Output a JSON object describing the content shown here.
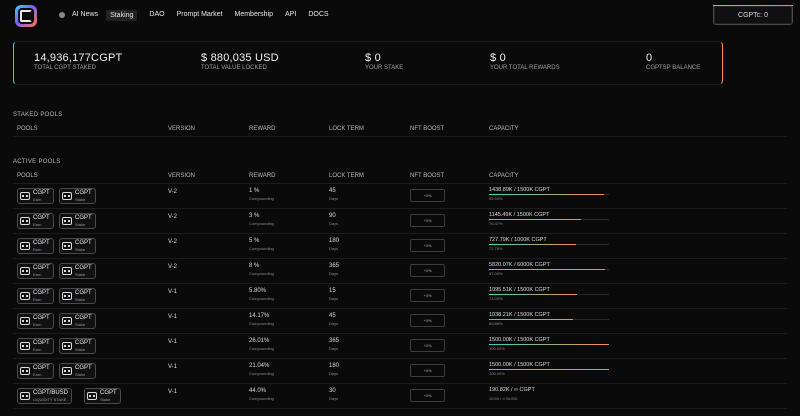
{
  "nav": {
    "items": [
      "AI News",
      "Staking",
      "DAO",
      "Prompt Market",
      "Membership",
      "API",
      "DOCS"
    ],
    "active": 1,
    "wallet_label": "CGPTc: 0"
  },
  "stats": [
    {
      "value": "14,936,177CGPT",
      "label": "TOTAL CGPT STAKED"
    },
    {
      "value": "$ 880,035 USD",
      "label": "TOTAL VALUE LOCKED"
    },
    {
      "value": "$ 0",
      "label": "YOUR STAKE"
    },
    {
      "value": "$ 0",
      "label": "YOUR TOTAL REWARDS"
    },
    {
      "value": "0",
      "label": "CGPTsp BALANCE"
    }
  ],
  "staked_pools": {
    "title": "STAKED POOLS",
    "headers": [
      "POOLS",
      "VERSION",
      "REWARD",
      "LOCK TERM",
      "NFT BOOST",
      "CAPACITY"
    ]
  },
  "active_pools": {
    "title": "ACTIVE POOLS",
    "headers": [
      "POOLS",
      "VERSION",
      "REWARD",
      "LOCK TERM",
      "NFT BOOST",
      "CAPACITY"
    ],
    "rows": [
      {
        "b1": {
          "t": "CGPT",
          "s": "Earn"
        },
        "b2": {
          "t": "CGPT",
          "s": "Stake"
        },
        "version": "V-2",
        "reward": "1 %",
        "reward_sub": "Compounding",
        "lock": "45",
        "lock_sub": "Days",
        "boost": "+0%",
        "cap": "1438.89K / 1500K CGPT",
        "cap_pct": "95.93%",
        "fill": 0.9593
      },
      {
        "b1": {
          "t": "CGPT",
          "s": "Earn"
        },
        "b2": {
          "t": "CGPT",
          "s": "Stake"
        },
        "version": "V-2",
        "reward": "3 %",
        "reward_sub": "Compounding",
        "lock": "90",
        "lock_sub": "Days",
        "boost": "+0%",
        "cap": "1145.49K / 1500K CGPT",
        "cap_pct": "76.37%",
        "fill": 0.7637
      },
      {
        "b1": {
          "t": "CGPT",
          "s": "Earn"
        },
        "b2": {
          "t": "CGPT",
          "s": "Stake"
        },
        "version": "V-2",
        "reward": "5 %",
        "reward_sub": "Compounding",
        "lock": "180",
        "lock_sub": "Days",
        "boost": "+0%",
        "cap": "727.79K / 1000K CGPT",
        "cap_pct": "72.78%",
        "fill": 0.7278
      },
      {
        "b1": {
          "t": "CGPT",
          "s": "Earn"
        },
        "b2": {
          "t": "CGPT",
          "s": "Stake"
        },
        "version": "V-2",
        "reward": "8 %",
        "reward_sub": "Compounding",
        "lock": "365",
        "lock_sub": "Days",
        "boost": "+0%",
        "cap": "5820.07K / 6000K CGPT",
        "cap_pct": "97.00%",
        "fill": 0.97
      },
      {
        "b1": {
          "t": "CGPT",
          "s": "Earn"
        },
        "b2": {
          "t": "CGPT",
          "s": "Stake"
        },
        "version": "V-1",
        "reward": "5.80%",
        "reward_sub": "Compounding",
        "lock": "15",
        "lock_sub": "Days",
        "boost": "+0%",
        "cap": "1095.51K / 1500K CGPT",
        "cap_pct": "73.03%",
        "fill": 0.7303
      },
      {
        "b1": {
          "t": "CGPT",
          "s": "Earn"
        },
        "b2": {
          "t": "CGPT",
          "s": "Stake"
        },
        "version": "V-1",
        "reward": "14.17%",
        "reward_sub": "Compounding",
        "lock": "45",
        "lock_sub": "Days",
        "boost": "+0%",
        "cap": "1038.21K / 1500K CGPT",
        "cap_pct": "69.88%",
        "fill": 0.6988
      },
      {
        "b1": {
          "t": "CGPT",
          "s": "Earn"
        },
        "b2": {
          "t": "CGPT",
          "s": "Stake"
        },
        "version": "V-1",
        "reward": "26.01%",
        "reward_sub": "Compounding",
        "lock": "365",
        "lock_sub": "Days",
        "boost": "+0%",
        "cap": "1500.00K / 1500K CGPT",
        "cap_pct": "100.00%",
        "fill": 1.0
      },
      {
        "b1": {
          "t": "CGPT",
          "s": "Earn"
        },
        "b2": {
          "t": "CGPT",
          "s": "Stake"
        },
        "version": "V-1",
        "reward": "21.04%",
        "reward_sub": "Compounding",
        "lock": "180",
        "lock_sub": "Days",
        "boost": "+0%",
        "cap": "1500.00K / 1500K CGPT",
        "cap_pct": "100.00%",
        "fill": 1.0
      },
      {
        "b1": {
          "t": "CGPT/BUSD",
          "s": "LIQUIDITY STAKE"
        },
        "b2": {
          "t": "CGPT",
          "s": "Stake"
        },
        "version": "V-1",
        "reward": "44.0%",
        "reward_sub": "Compounding",
        "lock": "30",
        "lock_sub": "Days",
        "boost": "+0%",
        "cap": "190.82K / ∞ CGPT",
        "cap_pct": "10.59 / ∞ BUSD",
        "fill": 0
      }
    ]
  },
  "colors": {
    "bg": "#0a0a0b",
    "accent_start": "#2dd6c9",
    "accent_end": "#ff8a3d"
  }
}
